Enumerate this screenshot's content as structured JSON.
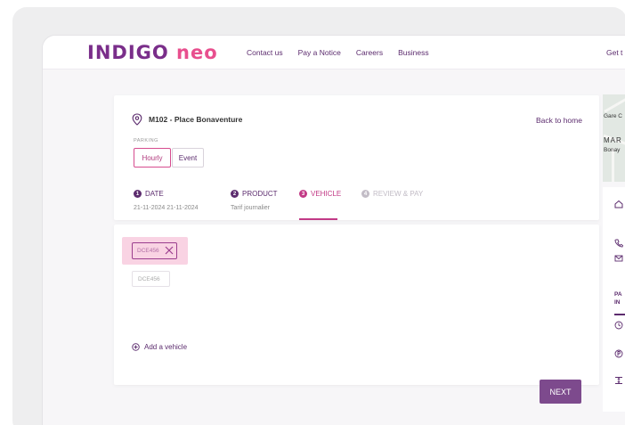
{
  "brand": {
    "logo_part1": "INDIGO",
    "logo_part2": "neo",
    "primary_color": "#7a2e8a",
    "accent_color": "#e84f8e"
  },
  "nav": {
    "items": [
      "Contact us",
      "Pay a Notice",
      "Careers",
      "Business"
    ],
    "right_label": "Get t"
  },
  "location": {
    "icon": "location-pin-icon",
    "name": "M102 - Place Bonaventure",
    "back_label": "Back to home"
  },
  "parking": {
    "label": "PARKING",
    "options": [
      "Hourly",
      "Event"
    ],
    "selected": "Hourly"
  },
  "steps": [
    {
      "num": "1",
      "label": "DATE",
      "sub": "21-11-2024   21-11-2024",
      "state": "done"
    },
    {
      "num": "2",
      "label": "PRODUCT",
      "sub": "Tarif journalier",
      "state": "done"
    },
    {
      "num": "3",
      "label": "VEHICLE",
      "sub": "",
      "state": "active"
    },
    {
      "num": "4",
      "label": "REVIEW & PAY",
      "sub": "",
      "state": "upcoming"
    }
  ],
  "vehicle": {
    "selected_plate": "DCE456",
    "input_value": "DCE456",
    "add_label": "Add a vehicle",
    "next_label": "NEXT"
  },
  "map": {
    "labels": [
      "Gare C",
      "MAR",
      "Bonay"
    ]
  },
  "side": {
    "section_label": "PA\nIN"
  }
}
